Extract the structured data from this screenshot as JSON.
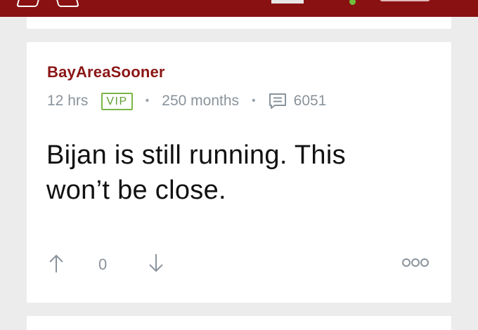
{
  "post": {
    "username": "BayAreaSooner",
    "time_ago": "12 hrs",
    "badge": "VIP",
    "membership": "250 months",
    "separator": "•",
    "post_count": "6051",
    "body": "Bijan is still running. This won’t be close.",
    "vote_count": "0"
  },
  "icons": {
    "comment": "comment-icon",
    "upvote": "arrow-up-icon",
    "downvote": "arrow-down-icon",
    "more": "more-options-icon"
  },
  "colors": {
    "brand": "#8a1111",
    "username": "#8b1616",
    "vip": "#7ab648",
    "meta": "#8a939b",
    "background": "#ececec"
  }
}
